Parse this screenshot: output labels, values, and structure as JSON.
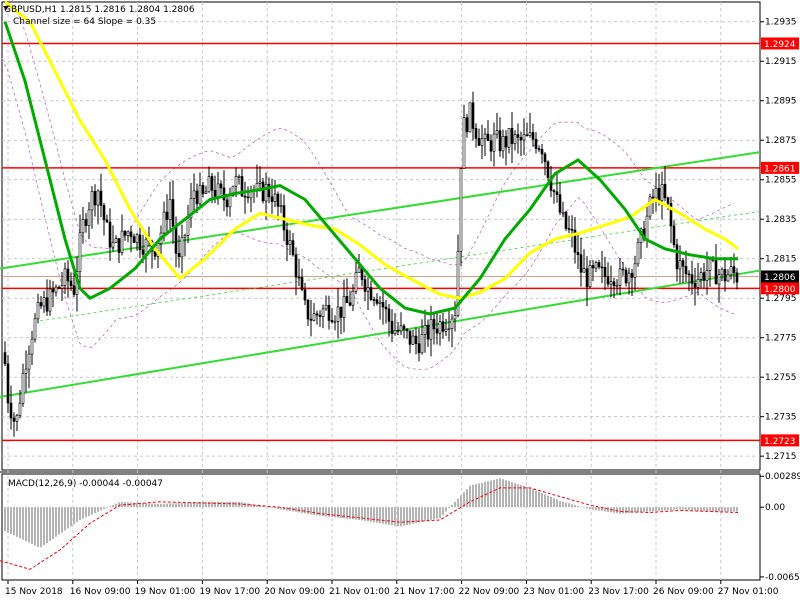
{
  "header": {
    "symbol_line": "GBPUSD,H1  1.2815 1.2816 1.2804 1.2806",
    "channel_line": "Channel size = 64 Slope = 0.35"
  },
  "colors": {
    "background": "#ffffff",
    "grid": "#c8c8c8",
    "candle": "#000000",
    "sma_fast": "#ffff00",
    "sma_slow": "#00aa00",
    "channel": "#33dd33",
    "level_line": "#ff0000",
    "level_tag_bg": "#ff0000",
    "bid_tag_bg": "#000000",
    "macd_hist": "#b4b4b4",
    "macd_signal": "#ff0000",
    "envelope": "#cc66cc"
  },
  "chart_data": [
    {
      "type": "candlestick",
      "title": "GBPUSD,H1",
      "ylim": [
        1.2708,
        1.2945
      ],
      "y_ticks": [
        "1.2935",
        "1.2915",
        "1.2895",
        "1.2875",
        "1.2855",
        "1.2835",
        "1.2815",
        "1.2795",
        "1.2775",
        "1.2755",
        "1.2735",
        "1.2715"
      ],
      "x_ticks": [
        "15 Nov 2018",
        "16 Nov 09:00",
        "19 Nov 01:00",
        "19 Nov 17:00",
        "20 Nov 09:00",
        "21 Nov 01:00",
        "21 Nov 17:00",
        "22 Nov 09:00",
        "23 Nov 01:00",
        "23 Nov 17:00",
        "26 Nov 09:00",
        "27 Nov 01:00"
      ],
      "levels": [
        {
          "label": "1.2924",
          "value": 1.2924
        },
        {
          "label": "1.2861",
          "value": 1.2861
        },
        {
          "label": "1.2800",
          "value": 1.28
        },
        {
          "label": "1.2723",
          "value": 1.2723
        }
      ],
      "current_price": {
        "label": "1.2806",
        "value": 1.2806
      },
      "close_path": [
        [
          0,
          1.279
        ],
        [
          8,
          1.2745
        ],
        [
          16,
          1.273
        ],
        [
          24,
          1.276
        ],
        [
          32,
          1.2778
        ],
        [
          40,
          1.279
        ],
        [
          50,
          1.2795
        ],
        [
          58,
          1.28
        ],
        [
          66,
          1.2805
        ],
        [
          74,
          1.28
        ],
        [
          82,
          1.283
        ],
        [
          90,
          1.2845
        ],
        [
          98,
          1.285
        ],
        [
          106,
          1.283
        ],
        [
          114,
          1.282
        ],
        [
          122,
          1.2825
        ],
        [
          130,
          1.283
        ],
        [
          138,
          1.2825
        ],
        [
          146,
          1.2822
        ],
        [
          154,
          1.282
        ],
        [
          162,
          1.283
        ],
        [
          170,
          1.2845
        ],
        [
          178,
          1.281
        ],
        [
          186,
          1.283
        ],
        [
          194,
          1.285
        ],
        [
          202,
          1.2845
        ],
        [
          210,
          1.2852
        ],
        [
          218,
          1.2848
        ],
        [
          226,
          1.2845
        ],
        [
          234,
          1.2855
        ],
        [
          242,
          1.285
        ],
        [
          250,
          1.2852
        ],
        [
          258,
          1.2848
        ],
        [
          266,
          1.285
        ],
        [
          272,
          1.2848
        ],
        [
          280,
          1.2838
        ],
        [
          288,
          1.2825
        ],
        [
          296,
          1.281
        ],
        [
          304,
          1.279
        ],
        [
          312,
          1.2785
        ],
        [
          320,
          1.2788
        ],
        [
          328,
          1.279
        ],
        [
          336,
          1.2788
        ],
        [
          344,
          1.279
        ],
        [
          352,
          1.2795
        ],
        [
          360,
          1.281
        ],
        [
          368,
          1.28
        ],
        [
          376,
          1.2798
        ],
        [
          384,
          1.279
        ],
        [
          392,
          1.278
        ],
        [
          400,
          1.2778
        ],
        [
          408,
          1.2775
        ],
        [
          416,
          1.2772
        ],
        [
          424,
          1.2775
        ],
        [
          432,
          1.278
        ],
        [
          440,
          1.2782
        ],
        [
          448,
          1.2785
        ],
        [
          456,
          1.279
        ],
        [
          462,
          1.288
        ],
        [
          470,
          1.2888
        ],
        [
          478,
          1.2878
        ],
        [
          486,
          1.2872
        ],
        [
          494,
          1.2875
        ],
        [
          502,
          1.2873
        ],
        [
          510,
          1.2876
        ],
        [
          518,
          1.2874
        ],
        [
          526,
          1.2875
        ],
        [
          534,
          1.2876
        ],
        [
          542,
          1.2872
        ],
        [
          548,
          1.286
        ],
        [
          556,
          1.2845
        ],
        [
          564,
          1.2832
        ],
        [
          572,
          1.2826
        ],
        [
          580,
          1.281
        ],
        [
          588,
          1.2805
        ],
        [
          596,
          1.2808
        ],
        [
          604,
          1.2806
        ],
        [
          612,
          1.2808
        ],
        [
          620,
          1.2805
        ],
        [
          628,
          1.2808
        ],
        [
          636,
          1.2815
        ],
        [
          644,
          1.283
        ],
        [
          652,
          1.2845
        ],
        [
          660,
          1.285
        ],
        [
          668,
          1.284
        ],
        [
          676,
          1.2815
        ],
        [
          684,
          1.2808
        ],
        [
          692,
          1.2805
        ],
        [
          700,
          1.2806
        ],
        [
          708,
          1.281
        ],
        [
          716,
          1.2808
        ],
        [
          724,
          1.2806
        ],
        [
          732,
          1.2808
        ],
        [
          738,
          1.2806
        ]
      ],
      "sma_fast_path": [
        [
          5,
          1.2945
        ],
        [
          30,
          1.2935
        ],
        [
          55,
          1.291
        ],
        [
          80,
          1.2885
        ],
        [
          105,
          1.2865
        ],
        [
          130,
          1.284
        ],
        [
          155,
          1.282
        ],
        [
          180,
          1.2805
        ],
        [
          205,
          1.2815
        ],
        [
          235,
          1.283
        ],
        [
          260,
          1.2838
        ],
        [
          285,
          1.2835
        ],
        [
          310,
          1.2832
        ],
        [
          335,
          1.283
        ],
        [
          360,
          1.2822
        ],
        [
          385,
          1.2812
        ],
        [
          410,
          1.2805
        ],
        [
          440,
          1.2797
        ],
        [
          460,
          1.2795
        ],
        [
          480,
          1.2798
        ],
        [
          505,
          1.2805
        ],
        [
          530,
          1.2818
        ],
        [
          555,
          1.2825
        ],
        [
          580,
          1.2828
        ],
        [
          605,
          1.2832
        ],
        [
          630,
          1.2836
        ],
        [
          655,
          1.2845
        ],
        [
          680,
          1.2838
        ],
        [
          705,
          1.283
        ],
        [
          725,
          1.2825
        ],
        [
          738,
          1.282
        ]
      ],
      "sma_slow_path": [
        [
          5,
          1.2935
        ],
        [
          25,
          1.2905
        ],
        [
          45,
          1.2865
        ],
        [
          65,
          1.2825
        ],
        [
          80,
          1.28
        ],
        [
          90,
          1.2795
        ],
        [
          110,
          1.28
        ],
        [
          135,
          1.281
        ],
        [
          160,
          1.2825
        ],
        [
          185,
          1.2835
        ],
        [
          210,
          1.2845
        ],
        [
          235,
          1.2848
        ],
        [
          260,
          1.285
        ],
        [
          280,
          1.2852
        ],
        [
          305,
          1.2845
        ],
        [
          330,
          1.283
        ],
        [
          355,
          1.2815
        ],
        [
          380,
          1.28
        ],
        [
          405,
          1.279
        ],
        [
          430,
          1.2787
        ],
        [
          455,
          1.279
        ],
        [
          480,
          1.2805
        ],
        [
          505,
          1.2825
        ],
        [
          530,
          1.284
        ],
        [
          555,
          1.2858
        ],
        [
          578,
          1.2865
        ],
        [
          600,
          1.2855
        ],
        [
          625,
          1.284
        ],
        [
          645,
          1.2825
        ],
        [
          665,
          1.282
        ],
        [
          690,
          1.2817
        ],
        [
          715,
          1.2815
        ],
        [
          738,
          1.2815
        ]
      ],
      "channel_lines": [
        {
          "from": [
            0,
            1.281
          ],
          "to": [
            760,
            1.2869
          ]
        },
        {
          "from": [
            0,
            1.2745
          ],
          "to": [
            760,
            1.2809
          ]
        }
      ]
    },
    {
      "type": "macd",
      "title": "MACD(12,26,9) -0.00044 -0.00047",
      "ylim": [
        -0.0068,
        0.0031
      ],
      "y_ticks": [
        "0.00289",
        "0.00",
        "-0.00651"
      ],
      "histogram_path": [
        [
          0,
          -0.002
        ],
        [
          40,
          -0.0038
        ],
        [
          80,
          -0.0012
        ],
        [
          120,
          0.0005
        ],
        [
          160,
          0.0003
        ],
        [
          200,
          0.0005
        ],
        [
          240,
          0.0005
        ],
        [
          280,
          -0.0002
        ],
        [
          320,
          -0.0008
        ],
        [
          360,
          -0.0012
        ],
        [
          400,
          -0.0018
        ],
        [
          440,
          -0.001
        ],
        [
          470,
          0.002
        ],
        [
          500,
          0.0027
        ],
        [
          530,
          0.0018
        ],
        [
          560,
          0.0006
        ],
        [
          590,
          -0.0002
        ],
        [
          620,
          -0.0006
        ],
        [
          650,
          -0.0004
        ],
        [
          680,
          -0.0002
        ],
        [
          710,
          -0.0004
        ],
        [
          738,
          -0.0004
        ]
      ],
      "signal_path": [
        [
          0,
          -0.005
        ],
        [
          30,
          -0.0058
        ],
        [
          60,
          -0.004
        ],
        [
          90,
          -0.0015
        ],
        [
          120,
          0.0002
        ],
        [
          160,
          0.0005
        ],
        [
          200,
          0.0004
        ],
        [
          240,
          0.0003
        ],
        [
          280,
          0.0
        ],
        [
          320,
          -0.0006
        ],
        [
          360,
          -0.001
        ],
        [
          400,
          -0.0014
        ],
        [
          440,
          -0.0012
        ],
        [
          470,
          0.0005
        ],
        [
          500,
          0.0018
        ],
        [
          530,
          0.0018
        ],
        [
          560,
          0.001
        ],
        [
          590,
          0.0002
        ],
        [
          620,
          -0.0004
        ],
        [
          650,
          -0.0005
        ],
        [
          680,
          -0.0003
        ],
        [
          710,
          -0.0004
        ],
        [
          738,
          -0.0005
        ]
      ]
    }
  ]
}
